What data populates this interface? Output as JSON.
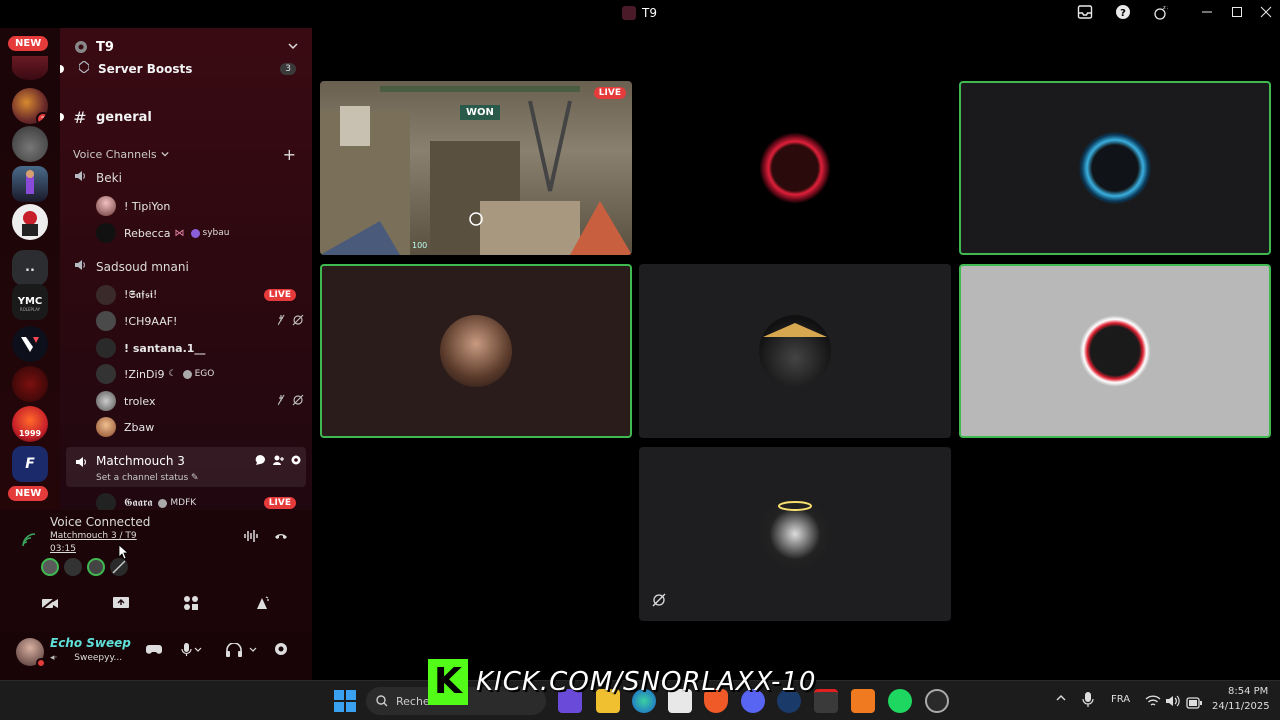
{
  "window": {
    "title": "T9"
  },
  "rail": {
    "new_badge_top": "NEW",
    "new_badge_bottom": "NEW",
    "dots": "..",
    "badge_count": "3"
  },
  "server": {
    "name": "T9",
    "boosts": {
      "label": "Server Boosts",
      "count": "3"
    },
    "general_channel": "general",
    "voice_header": "Voice Channels",
    "add_symbol": "+"
  },
  "channels": {
    "beki": {
      "name": "Beki",
      "users": [
        {
          "name": "! TipiYon"
        },
        {
          "name": "Rebecca",
          "tag": "sybau"
        }
      ]
    },
    "sadsoud": {
      "name": "Sadsoud mnani",
      "users": [
        {
          "name": "!𝕾𝖆𝖋𝖘𝖎!",
          "live": "LIVE"
        },
        {
          "name": "!CH9AAF!"
        },
        {
          "name": "! santana.1__"
        },
        {
          "name": "!ZinDi9",
          "tag": "EGO"
        },
        {
          "name": "trolex"
        },
        {
          "name": "Zbaw"
        }
      ]
    },
    "matchmouch": {
      "name": "Matchmouch 3",
      "status_prompt": "Set a channel status",
      "users": [
        {
          "name": "𝕲𝖆𝖆𝖗𝖆",
          "tag": "MDFK",
          "live": "LIVE"
        }
      ]
    }
  },
  "voice_panel": {
    "status": "Voice Connected",
    "location": "Matchmouch 3 / T9",
    "timer": "03:15"
  },
  "user_panel": {
    "display_name": "Echo Sweep",
    "status": "Sweepyy..."
  },
  "stage": {
    "live_badge": "LIVE",
    "game_banner": "WON",
    "hud_health": "100"
  },
  "taskbar": {
    "search_label": "Rechercher",
    "lang": "FRA",
    "time": "8:54 PM",
    "date": "24/11/2025",
    "overlay_text": "KICK.COM/SNORLAXX-10",
    "overlay_letter": "K"
  },
  "colors": {
    "speaking": "#3fb950",
    "live": "#e63b3b",
    "kick": "#53fc18",
    "sidebar": "#3a0a12"
  }
}
